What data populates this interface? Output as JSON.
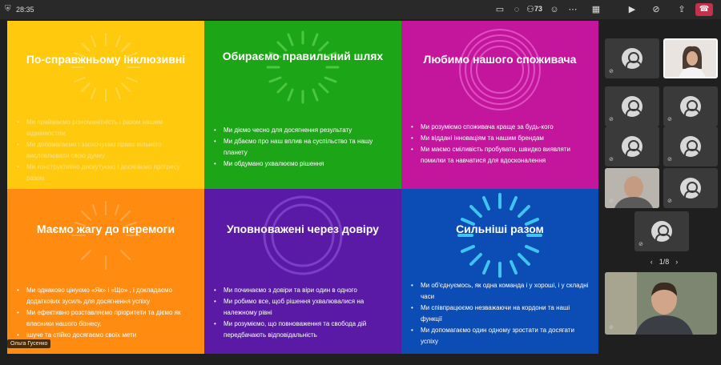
{
  "topbar": {
    "timer": "28:35",
    "people_count": "73",
    "icons": [
      "shield-icon",
      "share-screen-icon",
      "chat-icon",
      "people-icon",
      "reactions-icon",
      "more-icon",
      "camera-icon",
      "mic-muted-icon",
      "share-icon",
      "leave-call-icon"
    ]
  },
  "slide": {
    "cells": [
      {
        "title": "По-справжньому інклюзивні",
        "color": "#ffc90e",
        "bullets": [
          "Ми приймаємо різноманітність і разом нашим відмінностям",
          "Ми допомагаємо і заохочуємо право вільного висловлювати свою думку",
          "Ми конструктивно дискутуємо і досягаємо прогресу разом"
        ]
      },
      {
        "title": "Обираємо правильний шлях",
        "color": "#1ca516",
        "bullets": [
          "Ми діємо чесно для досягнення результату",
          "Ми дбаємо про наш вплив на суспільство та нашу планету",
          "Ми обдумано ухвалюємо рішення"
        ]
      },
      {
        "title": "Любимо нашого споживача",
        "color": "#c3169d",
        "bullets": [
          "Ми розуміємо споживача краще за будь-кого",
          "Ми віддані інноваціям та нашим брендам",
          "Ми маємо сміливість пробувати, швидко виявляти помилки та навчатися для вдосконалення"
        ]
      },
      {
        "title": "Маємо жагу до перемоги",
        "color": "#ff8c10",
        "bullets": [
          "Ми однаково цінуємо «Як» і «Що» , і докладаємо додаткових зусиль для досягнення успіху",
          "Ми ефективно розставляємо пріоритети та діємо як власники нашого бізнесу,",
          "ішуче та стійко досягаємо своїх мети"
        ]
      },
      {
        "title": "Уповноважені через довіру",
        "color": "#5a1aa6",
        "bullets": [
          "Ми починаємо з довіри та віри один в одного",
          "Ми робимо все, щоб рішення ухвалювалися на належному рівні",
          "Ми розуміємо, що повноваження та свобода дій передбачають відповідальність"
        ]
      },
      {
        "title": "Сильніші разом",
        "color": "#0b4db4",
        "bullets": [
          "Ми об'єднуємось, як одна команда і у хороші, і у складні часи",
          "Ми співпрацюємо незважаючи на кордони та наші функції",
          "Ми допомагаємо один одному зростати та досягати успіху"
        ]
      }
    ]
  },
  "presenter_label": "Ольга Гусенко",
  "pager": {
    "label": "1/8",
    "prev_icon": "chevron-left-icon",
    "next_icon": "chevron-right-icon"
  }
}
